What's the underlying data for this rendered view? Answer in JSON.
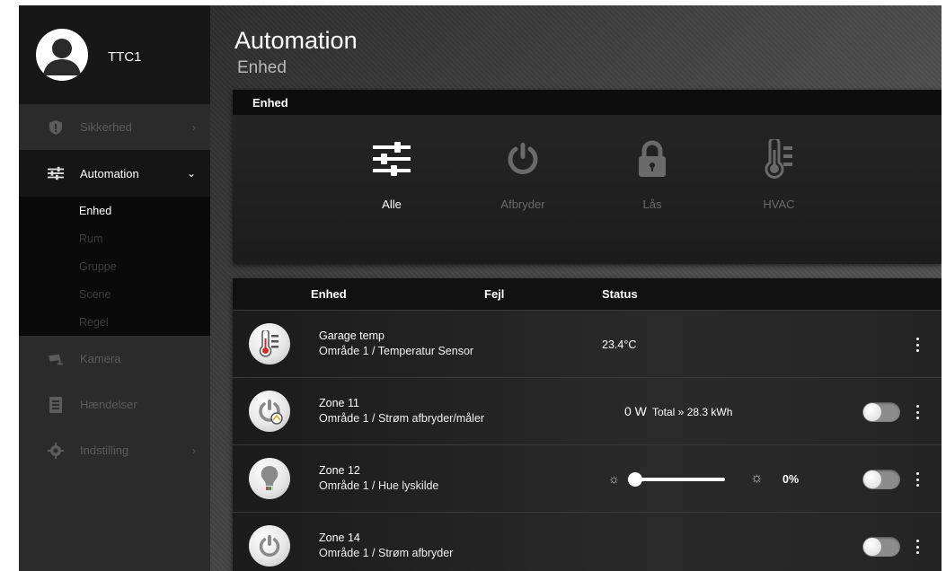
{
  "sidebar": {
    "username": "TTC1",
    "nav": [
      {
        "label": "Sikkerhed",
        "icon": "shield-icon"
      },
      {
        "label": "Automation",
        "icon": "sliders-icon"
      },
      {
        "label": "Kamera",
        "icon": "camera-icon"
      },
      {
        "label": "Hændelser",
        "icon": "log-icon"
      },
      {
        "label": "Indstilling",
        "icon": "gear-icon"
      }
    ],
    "automation_sub": [
      "Enhed",
      "Rum",
      "Gruppe",
      "Scene",
      "Regel"
    ],
    "active_sub": "Enhed"
  },
  "main": {
    "title": "Automation",
    "subtitle": "Enhed",
    "type_panel": {
      "header": "Enhed",
      "types": [
        {
          "label": "Alle",
          "icon": "sliders-icon",
          "active": true
        },
        {
          "label": "Afbryder",
          "icon": "power-icon",
          "active": false
        },
        {
          "label": "Lås",
          "icon": "lock-icon",
          "active": false
        },
        {
          "label": "HVAC",
          "icon": "thermometer-icon",
          "active": false
        }
      ]
    },
    "device_list": {
      "columns": [
        "Enhed",
        "Fejl",
        "Status"
      ],
      "rows": [
        {
          "name": "Garage temp",
          "area": "Område 1 / Temperatur Sensor",
          "status": "23.4°C",
          "icon": "thermometer-icon"
        },
        {
          "name": "Zone 11",
          "area": "Område 1 / Strøm afbryder/måler",
          "power": "0 W",
          "total": "Total » 28.3 kWh",
          "icon": "power-meter-icon",
          "toggle_on": false
        },
        {
          "name": "Zone 12",
          "area": "Område 1 / Hue lyskilde",
          "dim_level": "0%",
          "icon": "bulb-icon",
          "toggle_on": false
        },
        {
          "name": "Zone 14",
          "area": "Område 1 / Strøm afbryder",
          "icon": "power-icon",
          "toggle_on": false
        }
      ]
    }
  }
}
